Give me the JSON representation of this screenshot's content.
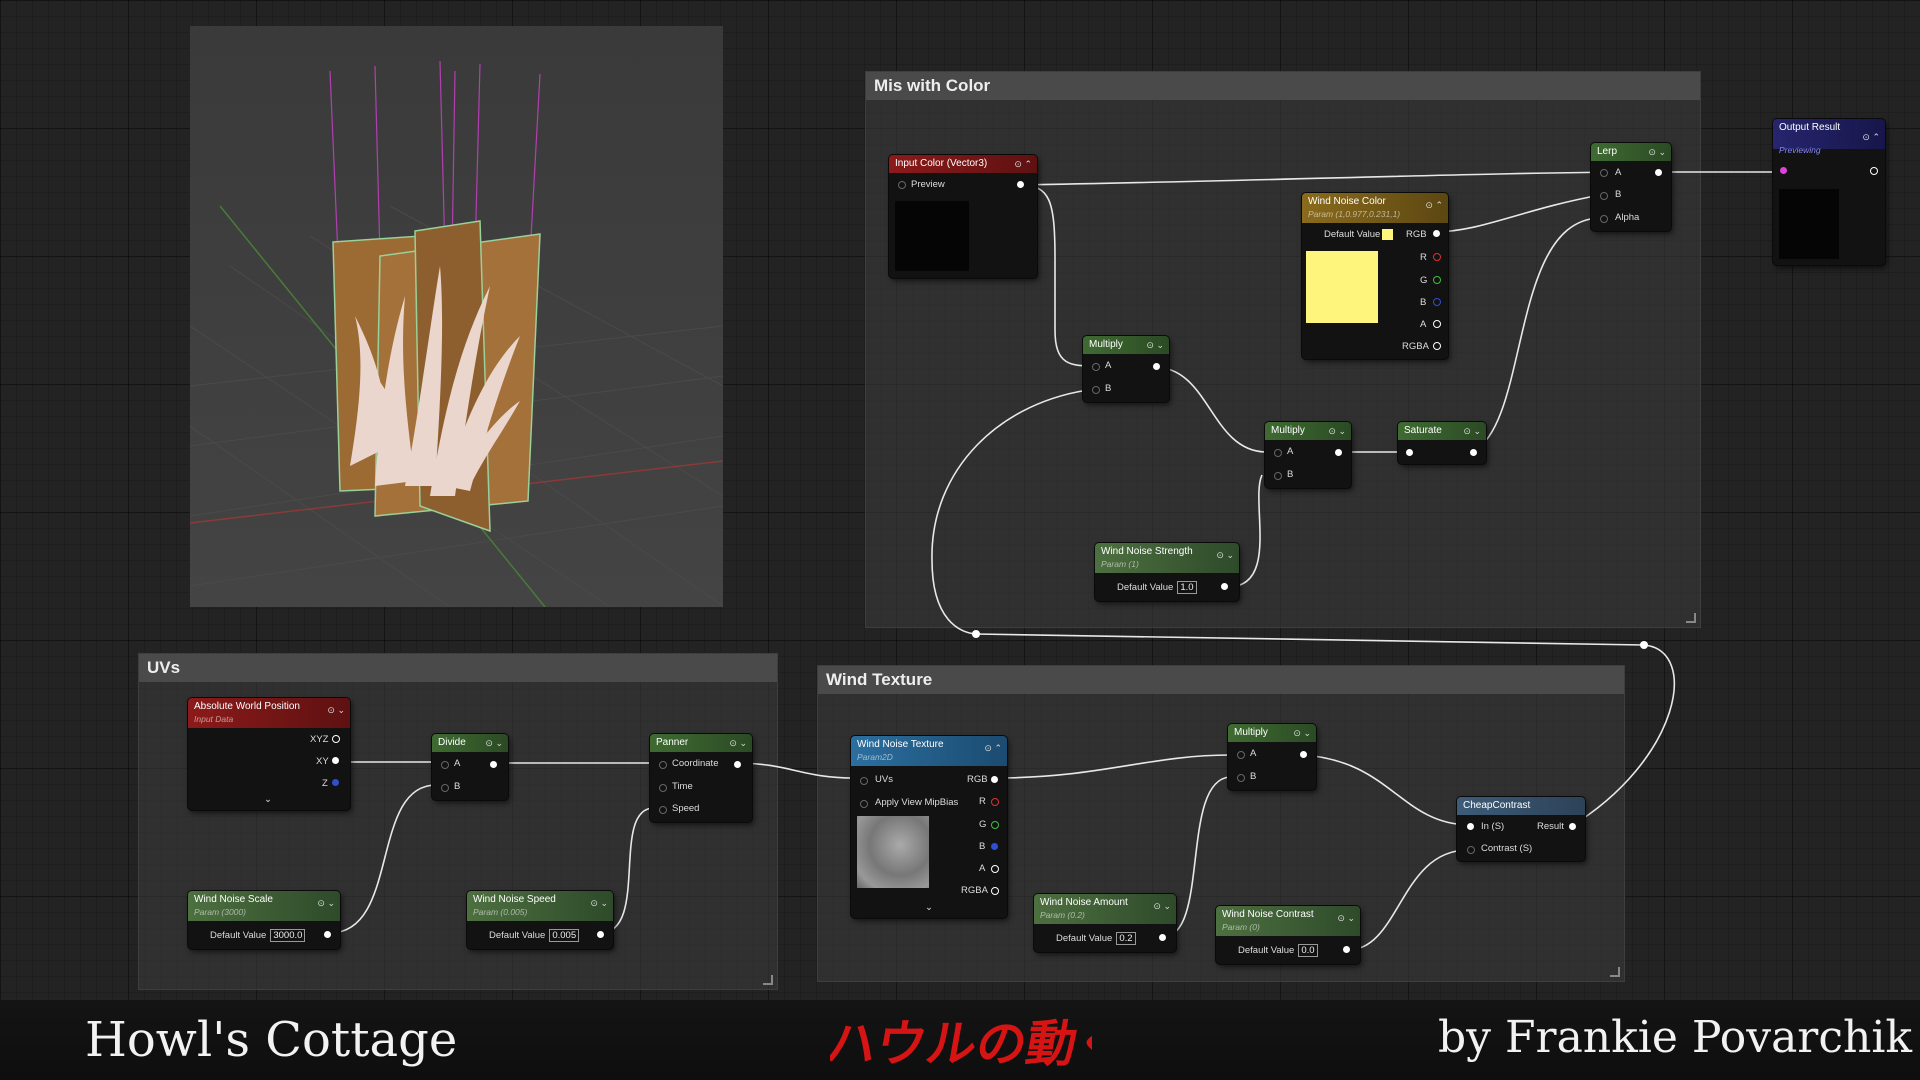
{
  "comments": {
    "mix_color": "Mis with Color",
    "uvs": "UVs",
    "wind_texture": "Wind Texture"
  },
  "nodes": {
    "input_color": {
      "title": "Input Color (Vector3)",
      "pin_preview": "Preview"
    },
    "output_result": {
      "title": "Output Result",
      "subtitle": "Previewing"
    },
    "lerp": {
      "title": "Lerp",
      "pin_a": "A",
      "pin_b": "B",
      "pin_alpha": "Alpha"
    },
    "wind_noise_color": {
      "title": "Wind Noise Color",
      "subtitle": "Param (1,0.977,0.231,1)",
      "default_label": "Default Value",
      "out_rgb": "RGB",
      "out_r": "R",
      "out_g": "G",
      "out_b": "B",
      "out_a": "A",
      "out_rgba": "RGBA",
      "swatch_color": "#fef57c"
    },
    "multiply_1": {
      "title": "Multiply",
      "pin_a": "A",
      "pin_b": "B"
    },
    "multiply_2": {
      "title": "Multiply",
      "pin_a": "A",
      "pin_b": "B"
    },
    "saturate": {
      "title": "Saturate"
    },
    "wind_noise_strength": {
      "title": "Wind Noise Strength",
      "subtitle": "Param (1)",
      "default_label": "Default Value",
      "value": "1.0"
    },
    "absolute_world_position": {
      "title": "Absolute World Position",
      "subtitle": "Input Data",
      "out_xyz": "XYZ",
      "out_xy": "XY",
      "out_z": "Z"
    },
    "divide": {
      "title": "Divide",
      "pin_a": "A",
      "pin_b": "B"
    },
    "panner": {
      "title": "Panner",
      "pin_coordinate": "Coordinate",
      "pin_time": "Time",
      "pin_speed": "Speed"
    },
    "wind_noise_scale": {
      "title": "Wind Noise Scale",
      "subtitle": "Param (3000)",
      "default_label": "Default Value",
      "value": "3000.0"
    },
    "wind_noise_speed": {
      "title": "Wind Noise Speed",
      "subtitle": "Param (0.005)",
      "default_label": "Default Value",
      "value": "0.005"
    },
    "wind_noise_texture": {
      "title": "Wind Noise Texture",
      "subtitle": "Param2D",
      "pin_uvs": "UVs",
      "pin_mip": "Apply View MipBias",
      "out_rgb": "RGB",
      "out_r": "R",
      "out_g": "G",
      "out_b": "B",
      "out_a": "A",
      "out_rgba": "RGBA"
    },
    "multiply_3": {
      "title": "Multiply",
      "pin_a": "A",
      "pin_b": "B"
    },
    "cheap_contrast": {
      "title": "CheapContrast",
      "pin_in": "In (S)",
      "pin_contrast": "Contrast (S)",
      "out_result": "Result"
    },
    "wind_noise_amount": {
      "title": "Wind Noise Amount",
      "subtitle": "Param (0.2)",
      "default_label": "Default Value",
      "value": "0.2"
    },
    "wind_noise_contrast": {
      "title": "Wind Noise Contrast",
      "subtitle": "Param (0)",
      "default_label": "Default Value",
      "value": "0.0"
    }
  },
  "footer": {
    "left_title": "Howl's Cottage",
    "right_credit": "by Frankie Povarchik",
    "logo_text": "ハウルの動く城"
  },
  "colors": {
    "pin_r": "#e03030",
    "pin_g": "#3fbf3f",
    "pin_b": "#2f4fd0",
    "output_pin": "#e040e0"
  }
}
